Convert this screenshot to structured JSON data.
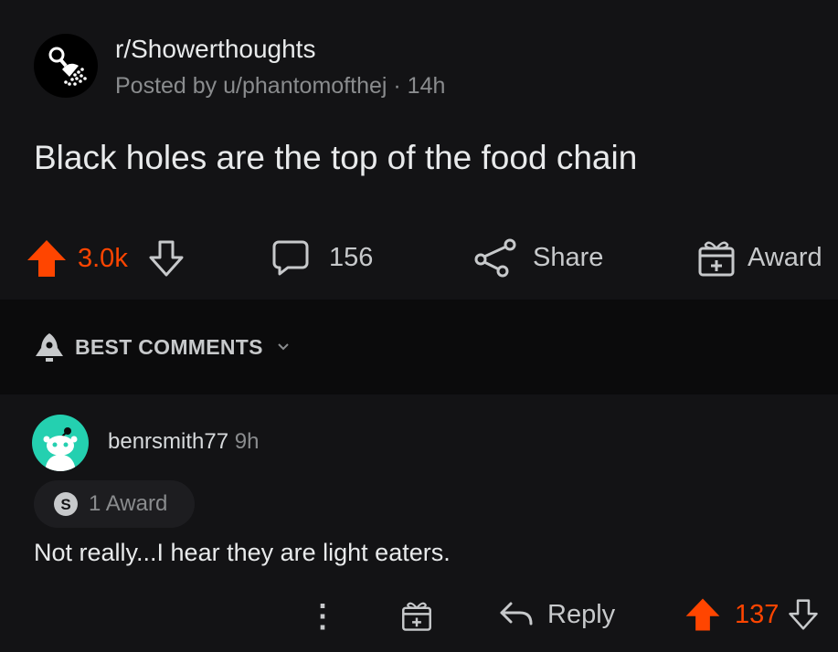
{
  "post": {
    "subreddit": "r/Showerthoughts",
    "posted_by": "Posted by u/phantomofthej",
    "dot": "·",
    "time": "14h",
    "title": "Black holes are the top of the food chain",
    "upvotes": "3.0k",
    "comments": "156",
    "share_label": "Share",
    "award_label": "Award"
  },
  "sort": {
    "label": "BEST COMMENTS"
  },
  "comment": {
    "username": "benrsmith77",
    "time": "9h",
    "awards": "1 Award",
    "award_badge": "S",
    "body": "Not really...I hear they are light eaters.",
    "reply_label": "Reply",
    "votes": "137",
    "more_icon": "⋮"
  },
  "colors": {
    "upvote": "#ff4500",
    "avatar": "#24d0b0",
    "background": "#131315"
  }
}
